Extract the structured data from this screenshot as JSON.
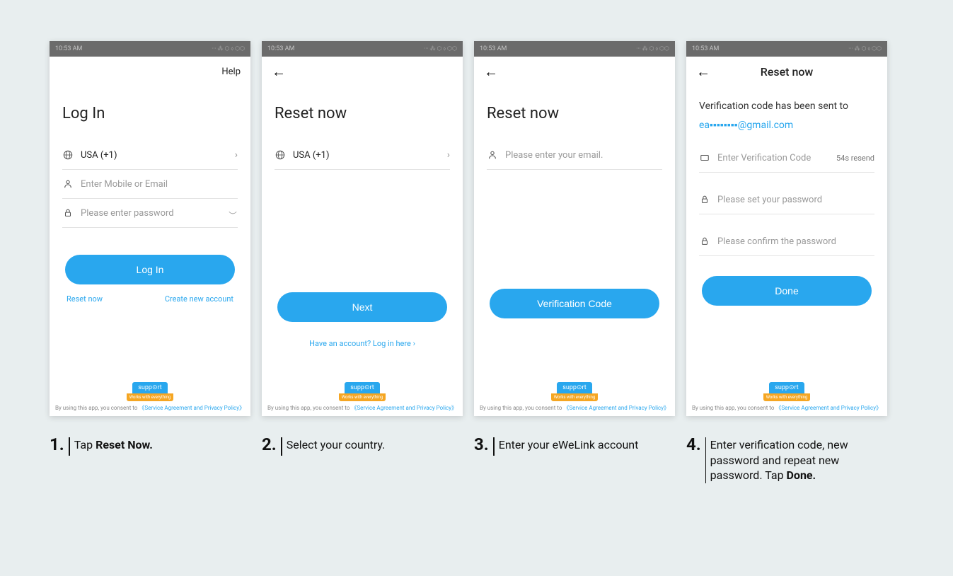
{
  "status": {
    "time": "10:53 AM",
    "icons": "··· ⁂ ⬡  ⬨ ⬡⬡"
  },
  "screen1": {
    "help": "Help",
    "title": "Log In",
    "country": "USA (+1)",
    "mobile_placeholder": "Enter Mobile or Email",
    "password_placeholder": "Please enter password",
    "button": "Log In",
    "reset_link": "Reset now",
    "create_link": "Create new account"
  },
  "screen2": {
    "title": "Reset now",
    "country": "USA (+1)",
    "button": "Next",
    "login_link": "Have an account? Log in here"
  },
  "screen3": {
    "title": "Reset now",
    "email_placeholder": "Please enter your email.",
    "button": "Verification Code"
  },
  "screen4": {
    "header": "Reset now",
    "sent_text": "Verification code has been sent to",
    "email": "ea▪▪▪▪▪▪▪▪@gmail.com",
    "code_placeholder": "Enter Verification Code",
    "resend": "54s resend",
    "pass_placeholder": "Please set your password",
    "confirm_placeholder": "Please confirm the password",
    "button": "Done"
  },
  "footer": {
    "logo_top": "supp⊙rt",
    "logo_bot": "Works with everything",
    "consent": "By using this app, you consent to ",
    "policy": "《Service Agreement and Privacy Policy》"
  },
  "captions": {
    "c1_num": "1.",
    "c1_a": "Tap ",
    "c1_b": "Reset Now.",
    "c2_num": "2.",
    "c2": "Select your country.",
    "c3_num": "3.",
    "c3": "Enter your eWeLink account",
    "c4_num": "4.",
    "c4_a": "Enter verification code, new password and repeat new password. Tap ",
    "c4_b": "Done."
  }
}
